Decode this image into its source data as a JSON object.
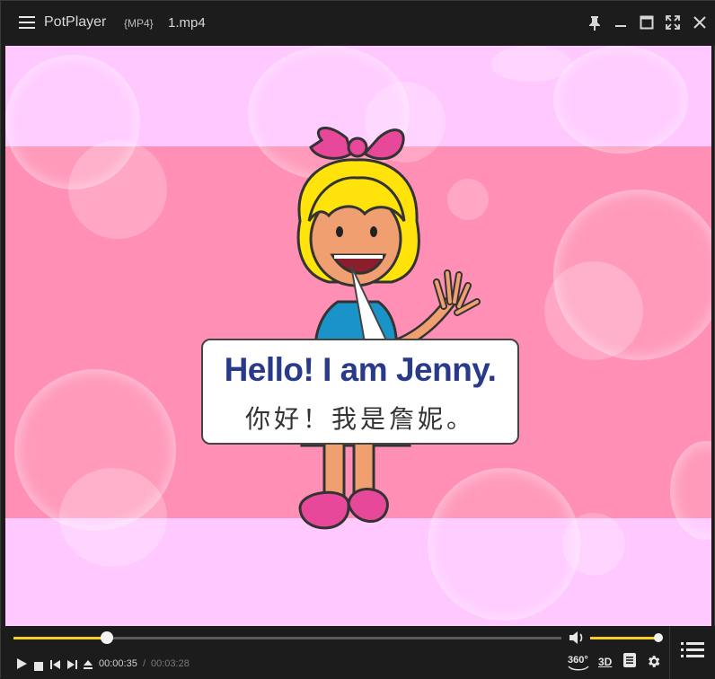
{
  "titlebar": {
    "app_name": "PotPlayer",
    "format": "{MP4}",
    "filename": "1.mp4",
    "icons": [
      "menu-icon",
      "pin-icon",
      "minimize-icon",
      "maximize-icon",
      "fullscreen-icon",
      "close-icon"
    ]
  },
  "video": {
    "speech_en": "Hello! I am Jenny.",
    "speech_zh": "你好！我是詹妮。",
    "colors": {
      "background": "#ffc8ff",
      "band": "#ff8fb4",
      "text_en": "#2a3a8a"
    }
  },
  "controls": {
    "current_time": "00:00:35",
    "separator": "/",
    "duration": "00:03:28",
    "progress": 0.17,
    "volume": 1.0,
    "vr_label": "360°",
    "threed_label": "3D",
    "accent": "#f4d21f",
    "icons": [
      "play-icon",
      "stop-icon",
      "previous-icon",
      "next-icon",
      "eject-icon",
      "volume-icon",
      "360-icon",
      "3d-icon",
      "subtitle-icon",
      "settings-icon",
      "playlist-icon"
    ]
  }
}
